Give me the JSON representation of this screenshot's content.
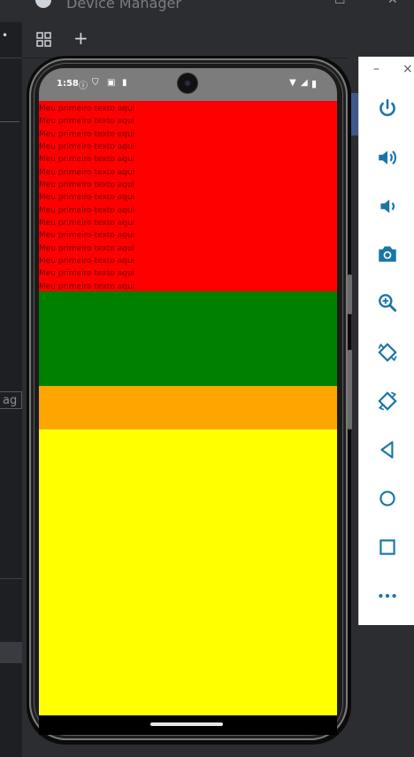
{
  "ide": {
    "window_title": "Device Manager",
    "left_strip_text": "ag",
    "toolbar_add": "+"
  },
  "phone": {
    "status_time": "1:58",
    "content": {
      "text_lines": [
        "Meu primeiro texto aqui",
        "Meu primeiro texto aqui",
        "Meu primeiro texto aqui",
        "Meu primeiro texto aqui",
        "Meu primeiro texto aqui",
        "Meu primeiro texto aqui",
        "Meu primeiro texto aqui",
        "Meu primeiro texto aqui",
        "Meu primeiro texto aqui",
        "Meu primeiro texto aqui",
        "Meu primeiro texto aqui",
        "Meu primeiro texto aqui",
        "Meu primeiro texto aqui",
        "Meu primeiro texto aqui",
        "Meu primeiro texto aqui"
      ],
      "block_colors": {
        "red": "#ff0000",
        "green": "#008000",
        "orange": "#ffa500",
        "yellow": "#ffff00"
      }
    }
  },
  "emulator_panel": {
    "minimize": "–",
    "close": "×",
    "buttons": [
      {
        "name": "power-icon"
      },
      {
        "name": "volume-up-icon"
      },
      {
        "name": "volume-down-icon"
      },
      {
        "name": "camera-icon"
      },
      {
        "name": "zoom-icon"
      },
      {
        "name": "rotate-left-icon"
      },
      {
        "name": "rotate-right-icon"
      },
      {
        "name": "back-icon"
      },
      {
        "name": "home-icon"
      },
      {
        "name": "overview-icon"
      },
      {
        "name": "more-icon"
      }
    ],
    "accent_color": "#1976a8"
  }
}
